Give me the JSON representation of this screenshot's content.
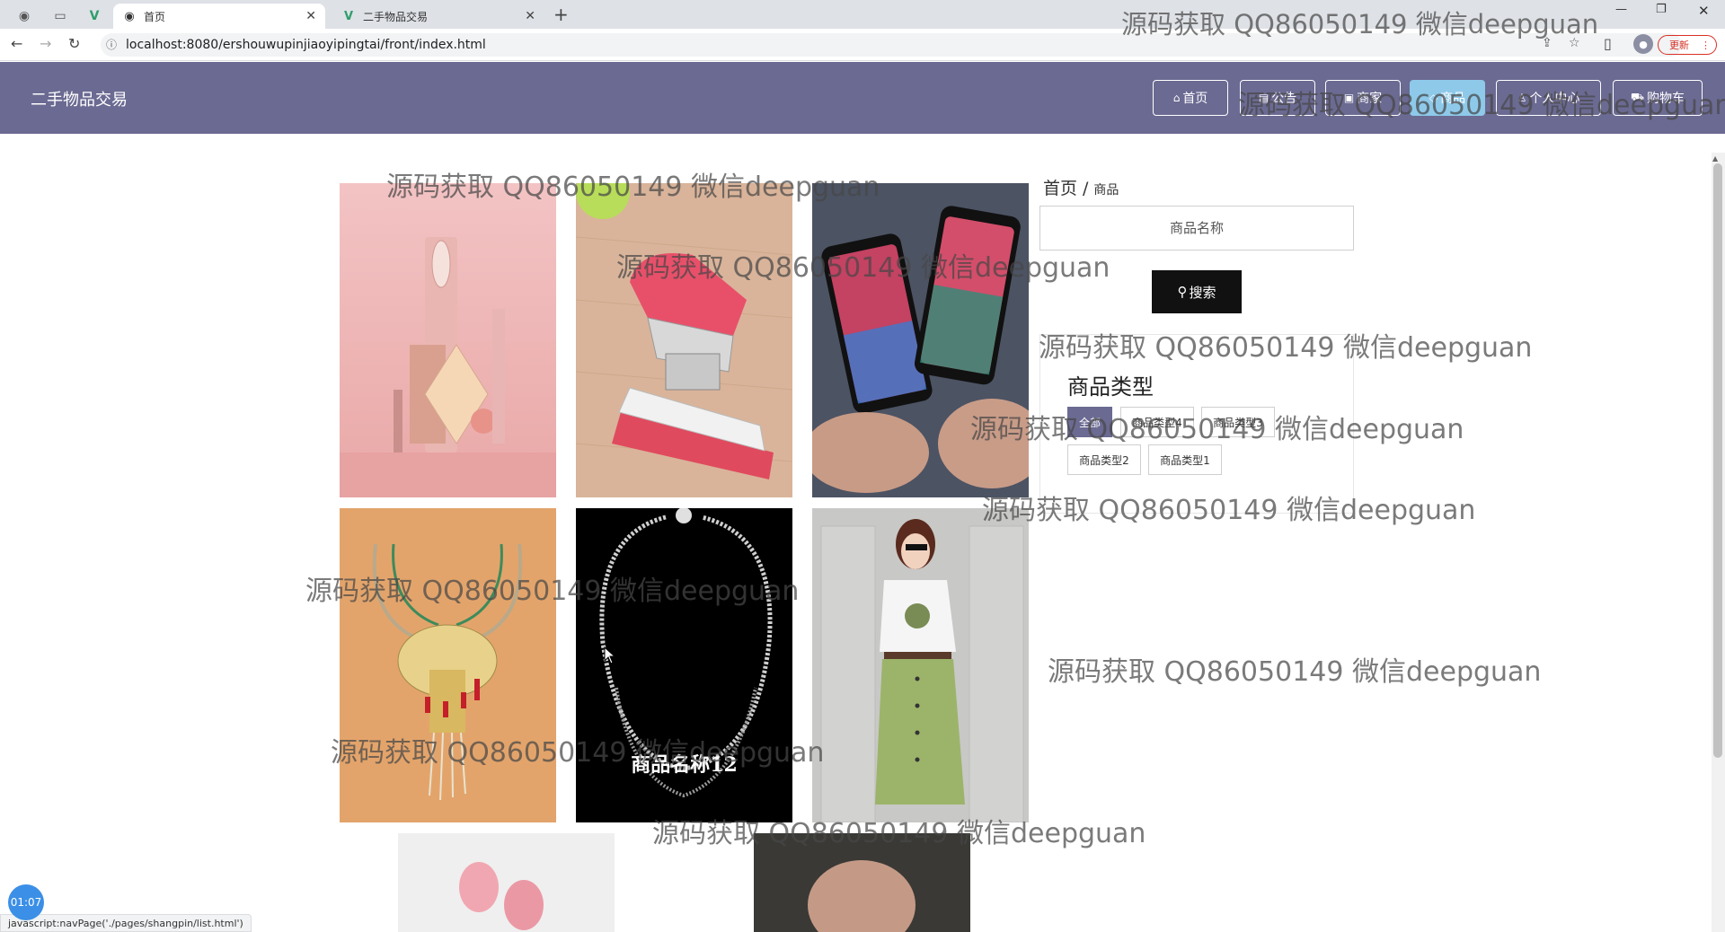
{
  "browser": {
    "tabs": [
      {
        "title": "首页",
        "active": true
      },
      {
        "title": "二手物品交易",
        "active": false
      }
    ],
    "url": "localhost:8080/ershouwupinjiaoyipingtai/front/index.html",
    "update_label": "更新"
  },
  "header": {
    "logo": "二手物品交易",
    "nav": [
      {
        "label": "首页",
        "icon": "home-icon"
      },
      {
        "label": "公告",
        "icon": "notice-icon"
      },
      {
        "label": "商家",
        "icon": "shop-icon"
      },
      {
        "label": "商品",
        "icon": "goods-icon",
        "active": true
      },
      {
        "label": "个人中心",
        "icon": "user-icon"
      },
      {
        "label": "购物车",
        "icon": "cart-icon"
      }
    ]
  },
  "products": [
    {
      "name": ""
    },
    {
      "name": ""
    },
    {
      "name": ""
    },
    {
      "name": ""
    },
    {
      "name": "商品名称12"
    },
    {
      "name": ""
    },
    {
      "name": ""
    },
    {
      "name": ""
    }
  ],
  "breadcrumb": {
    "home": "首页",
    "separator": "/",
    "current": "商品"
  },
  "search": {
    "placeholder": "商品名称",
    "button": "搜索"
  },
  "types": {
    "title": "商品类型",
    "tags": [
      "全部",
      "商品类型4",
      "商品类型3",
      "商品类型2",
      "商品类型1"
    ]
  },
  "status_url": "javascript:navPage('./pages/shangpin/list.html')",
  "timer": "01:07",
  "watermark": "源码获取 QQ86050149 微信deepguan",
  "colors": {
    "header": "#6b6a92",
    "active_nav": "#8ec9ea",
    "search_button": "#111111"
  }
}
